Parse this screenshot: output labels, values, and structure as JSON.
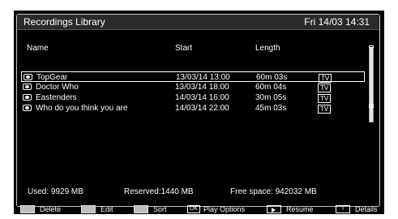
{
  "header": {
    "title": "Recordings Library",
    "datetime": "Fri 14/03 14:31"
  },
  "columns": {
    "name": "Name",
    "start": "Start",
    "length": "Length"
  },
  "recordings": [
    {
      "name": "TopGear",
      "start": "13/03/14 13:00",
      "length": "60m 03s",
      "type": "TV",
      "selected": true
    },
    {
      "name": "Doctor Who",
      "start": "13/03/14 18:00",
      "length": "60m 04s",
      "type": "TV",
      "selected": false
    },
    {
      "name": "Eastenders",
      "start": "14/03/14 16:00",
      "length": "30m 05s",
      "type": "TV",
      "selected": false
    },
    {
      "name": "Who do you think you are",
      "start": "14/03/14 22:00",
      "length": "45m 03s",
      "type": "TV",
      "selected": false
    }
  ],
  "status": {
    "used": "Used: 9929 MB",
    "reserved": "Reserved:1440 MB",
    "free": "Free space: 942032 MB"
  },
  "buttons": {
    "delete": "Delete",
    "edit": "Edit",
    "sort": "Sort",
    "ok_key": "OK",
    "play_options": "Play Options",
    "resume": "Resume",
    "info_key": "i",
    "details": "Details"
  },
  "icons": [
    "eye-icon",
    "tv-badge",
    "play-icon"
  ]
}
